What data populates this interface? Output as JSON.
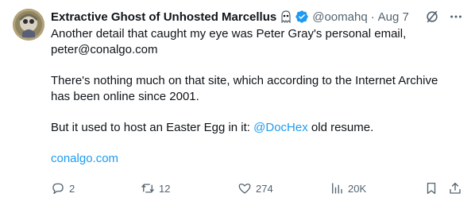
{
  "author": {
    "name": "Extractive Ghost of Unhosted Marcellus",
    "handle": "@oomahq",
    "date": "Aug 7",
    "separator": "·"
  },
  "tweet": {
    "line1": "Another detail that caught my eye was Peter Gray's personal email,",
    "line2": "peter@conalgo.com",
    "para2_line1": "There's nothing much on that site, which according to the Internet Archive",
    "para2_line2": "has been online since 2001.",
    "para3_before": "But it used to host an Easter Egg in it: ",
    "para3_mention": "@DocHex",
    "para3_after": " old resume.",
    "link": "conalgo.com"
  },
  "metrics": {
    "replies": "2",
    "reposts": "12",
    "likes": "274",
    "views": "20K"
  },
  "icons": {
    "verified_color": "#1d9bf0",
    "accent": "#1d9bf0"
  }
}
